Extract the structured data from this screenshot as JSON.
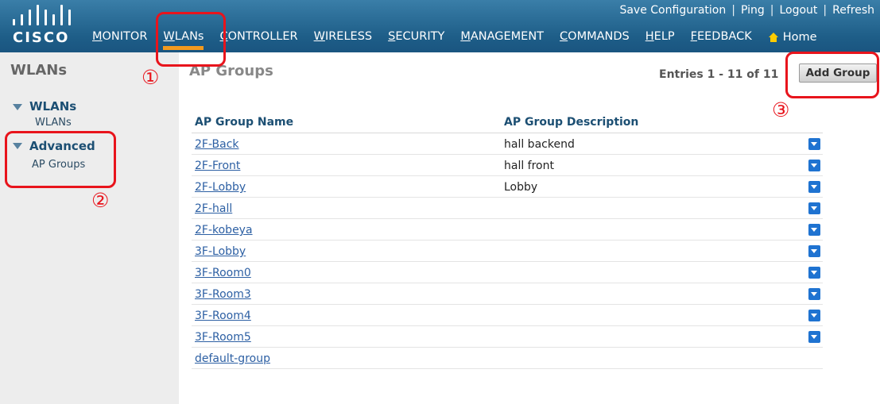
{
  "header": {
    "logo_text": "CISCO",
    "top_links": [
      "Save Configuration",
      "Ping",
      "Logout",
      "Refresh"
    ],
    "nav": [
      {
        "label": "MONITOR"
      },
      {
        "label": "WLANs"
      },
      {
        "label": "CONTROLLER"
      },
      {
        "label": "WIRELESS"
      },
      {
        "label": "SECURITY"
      },
      {
        "label": "MANAGEMENT"
      },
      {
        "label": "COMMANDS"
      },
      {
        "label": "HELP"
      },
      {
        "label": "FEEDBACK"
      }
    ],
    "home_label": "Home"
  },
  "sidebar": {
    "title": "WLANs",
    "sections": [
      {
        "title": "WLANs",
        "items": [
          "WLANs"
        ]
      },
      {
        "title": "Advanced",
        "items": [
          "AP Groups"
        ]
      }
    ]
  },
  "main": {
    "title": "AP Groups",
    "entries": "Entries 1 - 11 of 11",
    "add_button": "Add Group",
    "columns": [
      "AP Group Name",
      "AP Group Description"
    ],
    "rows": [
      {
        "name": "2F-Back",
        "description": "hall backend",
        "has_menu": true
      },
      {
        "name": "2F-Front",
        "description": "hall front",
        "has_menu": true
      },
      {
        "name": "2F-Lobby",
        "description": "Lobby",
        "has_menu": true
      },
      {
        "name": "2F-hall",
        "description": "",
        "has_menu": true
      },
      {
        "name": "2F-kobeya",
        "description": "",
        "has_menu": true
      },
      {
        "name": "3F-Lobby",
        "description": "",
        "has_menu": true
      },
      {
        "name": "3F-Room0",
        "description": "",
        "has_menu": true
      },
      {
        "name": "3F-Room3",
        "description": "",
        "has_menu": true
      },
      {
        "name": "3F-Room4",
        "description": "",
        "has_menu": true
      },
      {
        "name": "3F-Room5",
        "description": "",
        "has_menu": true
      },
      {
        "name": "default-group",
        "description": "",
        "has_menu": false
      }
    ]
  },
  "annotations": [
    "①",
    "②",
    "③"
  ],
  "colors": {
    "accent": "#e8141c",
    "header": "#1e5e88",
    "tab_underline": "#f39a1e",
    "link": "#2c5fa3"
  }
}
